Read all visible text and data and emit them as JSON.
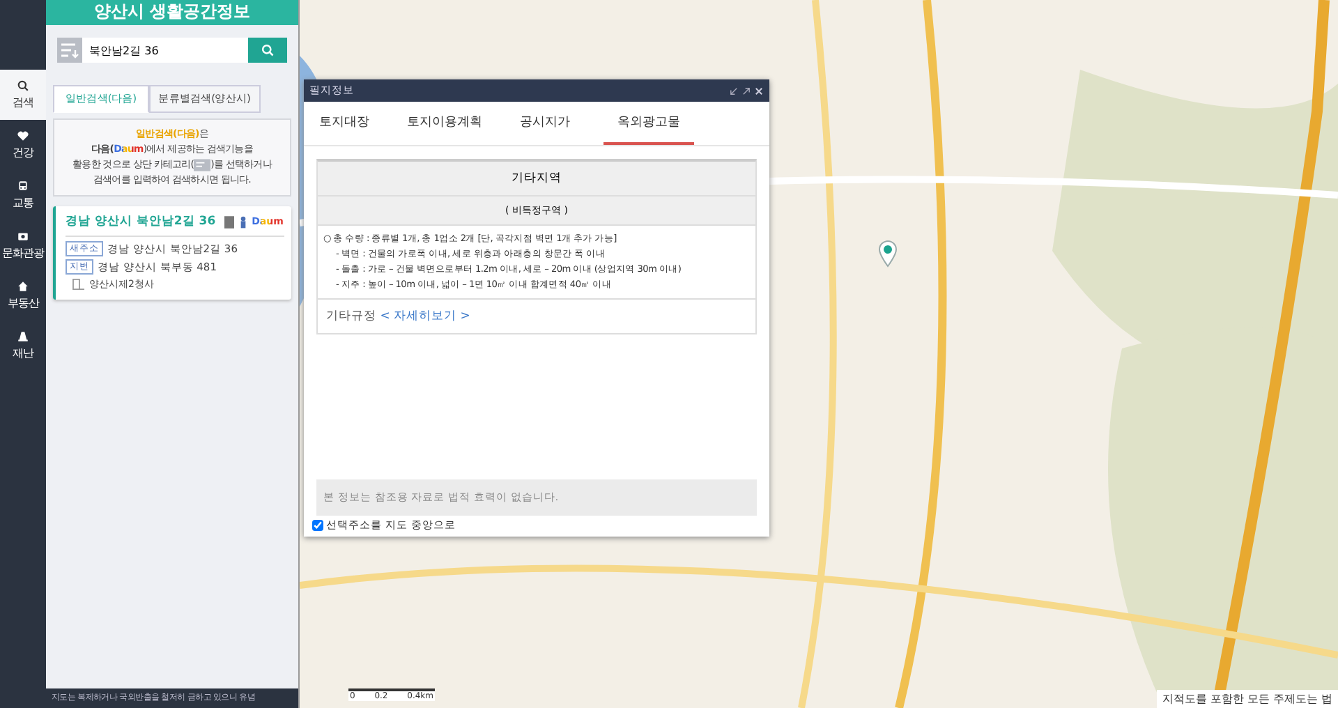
{
  "app": {
    "title": "양산시 생활공간정보"
  },
  "nav": [
    {
      "label": "검색",
      "selected": true
    },
    {
      "label": "건강",
      "selected": false
    },
    {
      "label": "교통",
      "selected": false
    },
    {
      "label": "문화관광",
      "selected": false
    },
    {
      "label": "부동산",
      "selected": false
    },
    {
      "label": "재난",
      "selected": false
    }
  ],
  "search": {
    "value": "북안남2길 36"
  },
  "search_tabs": [
    {
      "label": "일반검색(다음)",
      "selected": true
    },
    {
      "label": "분류별검색(양산시)",
      "selected": false
    }
  ],
  "info": {
    "highlight": "일반검색(다음)",
    "highlight_suffix": "은",
    "lines": [
      "다음(",
      ")에서 제공하는 검색기능을",
      "활용한 것으로 상단 카테고리(",
      ")를 선택하거나",
      "검색어를 입력하여 검색하시면 됩니다."
    ],
    "daum": "Daum"
  },
  "result": {
    "title": "경남 양산시 북안남2길 36",
    "logo": "Daum",
    "rows": [
      {
        "tag": "새주소",
        "text": "경남 양산시 북안남2길 36"
      },
      {
        "tag": "지번",
        "text": "경남 양산시 북부동 481"
      }
    ],
    "building": "양산시제2청사"
  },
  "footer_note": "지도는 복제하거나 국외반출을 철저히 금하고 있으니 유념",
  "dialog": {
    "title": "필지정보",
    "tabs": [
      {
        "label": "토지대장",
        "selected": false
      },
      {
        "label": "토지이용계획",
        "selected": false
      },
      {
        "label": "공시지가",
        "selected": false
      },
      {
        "label": "옥외광고물",
        "selected": true
      }
    ],
    "heading": "기타지역",
    "subheading": "( 비특정구역 )",
    "lines": [
      "○ 총 수량 : 종류별 1개, 총 1업소 2개 [단, 곡각지점 벽면 1개 추가 가능]",
      "- 벽면 : 건물의 가로폭 이내, 세로 위층과 아래층의 창문간 폭 이내",
      "- 돌출 : 가로 – 건물 벽면으로부터 1.2m 이내, 세로 – 20m 이내 (상업지역 30m 이내)",
      "- 지주 : 높이 – 10m 이내, 넓이 – 1면 10㎡ 이내 합계면적 40㎡ 이내"
    ],
    "other_label": "기타규정",
    "more_link": "< 자세히보기 >",
    "notice": "본 정보는 참조용 자료로 법적 효력이 없습니다.",
    "center_option": {
      "label": "선택주소를 지도 중앙으로",
      "checked": true
    }
  },
  "map": {
    "scale": [
      "0",
      "0.2",
      "0.4km"
    ],
    "disclaimer": "지적도를 포함한 모든 주제도는 법"
  }
}
